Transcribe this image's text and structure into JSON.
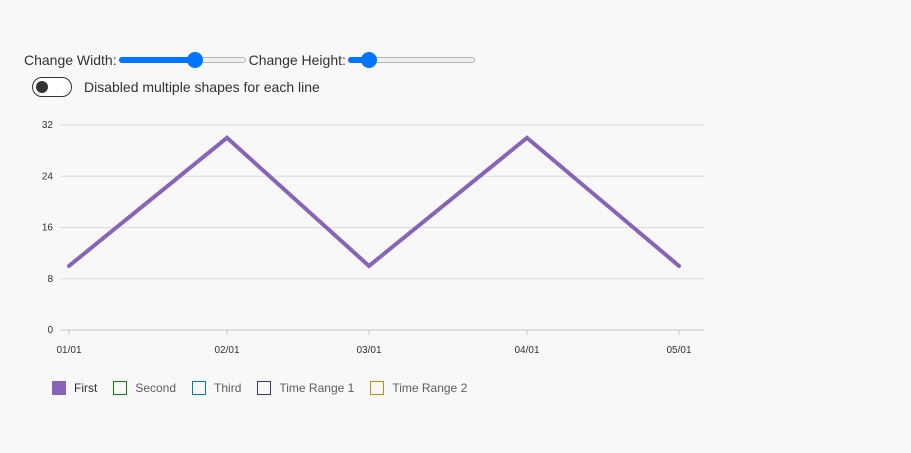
{
  "controls": {
    "width_label": "Change Width:",
    "width_value": 0.62,
    "height_label": "Change Height:",
    "height_value": 0.12,
    "toggle_label": "Disabled multiple shapes for each line",
    "toggle_on": false
  },
  "chart_data": {
    "type": "line",
    "title": "",
    "xlabel": "",
    "ylabel": "",
    "categories": [
      "01/01",
      "02/01",
      "03/01",
      "04/01",
      "05/01"
    ],
    "y_ticks": [
      "0",
      "8",
      "16",
      "24",
      "32"
    ],
    "ylim": [
      0,
      32
    ],
    "grid": true,
    "legend_position": "bottom-left",
    "series": [
      {
        "name": "First",
        "color": "#8764b8",
        "values": [
          10,
          30,
          10,
          30,
          10
        ]
      }
    ]
  },
  "legend": [
    {
      "label": "First",
      "color": "#8764b8",
      "active": true
    },
    {
      "label": "Second",
      "color": "#107c10",
      "active": false
    },
    {
      "label": "Third",
      "color": "#0078d4",
      "active": false
    },
    {
      "label": "Time Range 1",
      "color": "#3b3a6e",
      "active": false
    },
    {
      "label": "Time Range 2",
      "color": "#ca8a04",
      "active": false
    }
  ]
}
